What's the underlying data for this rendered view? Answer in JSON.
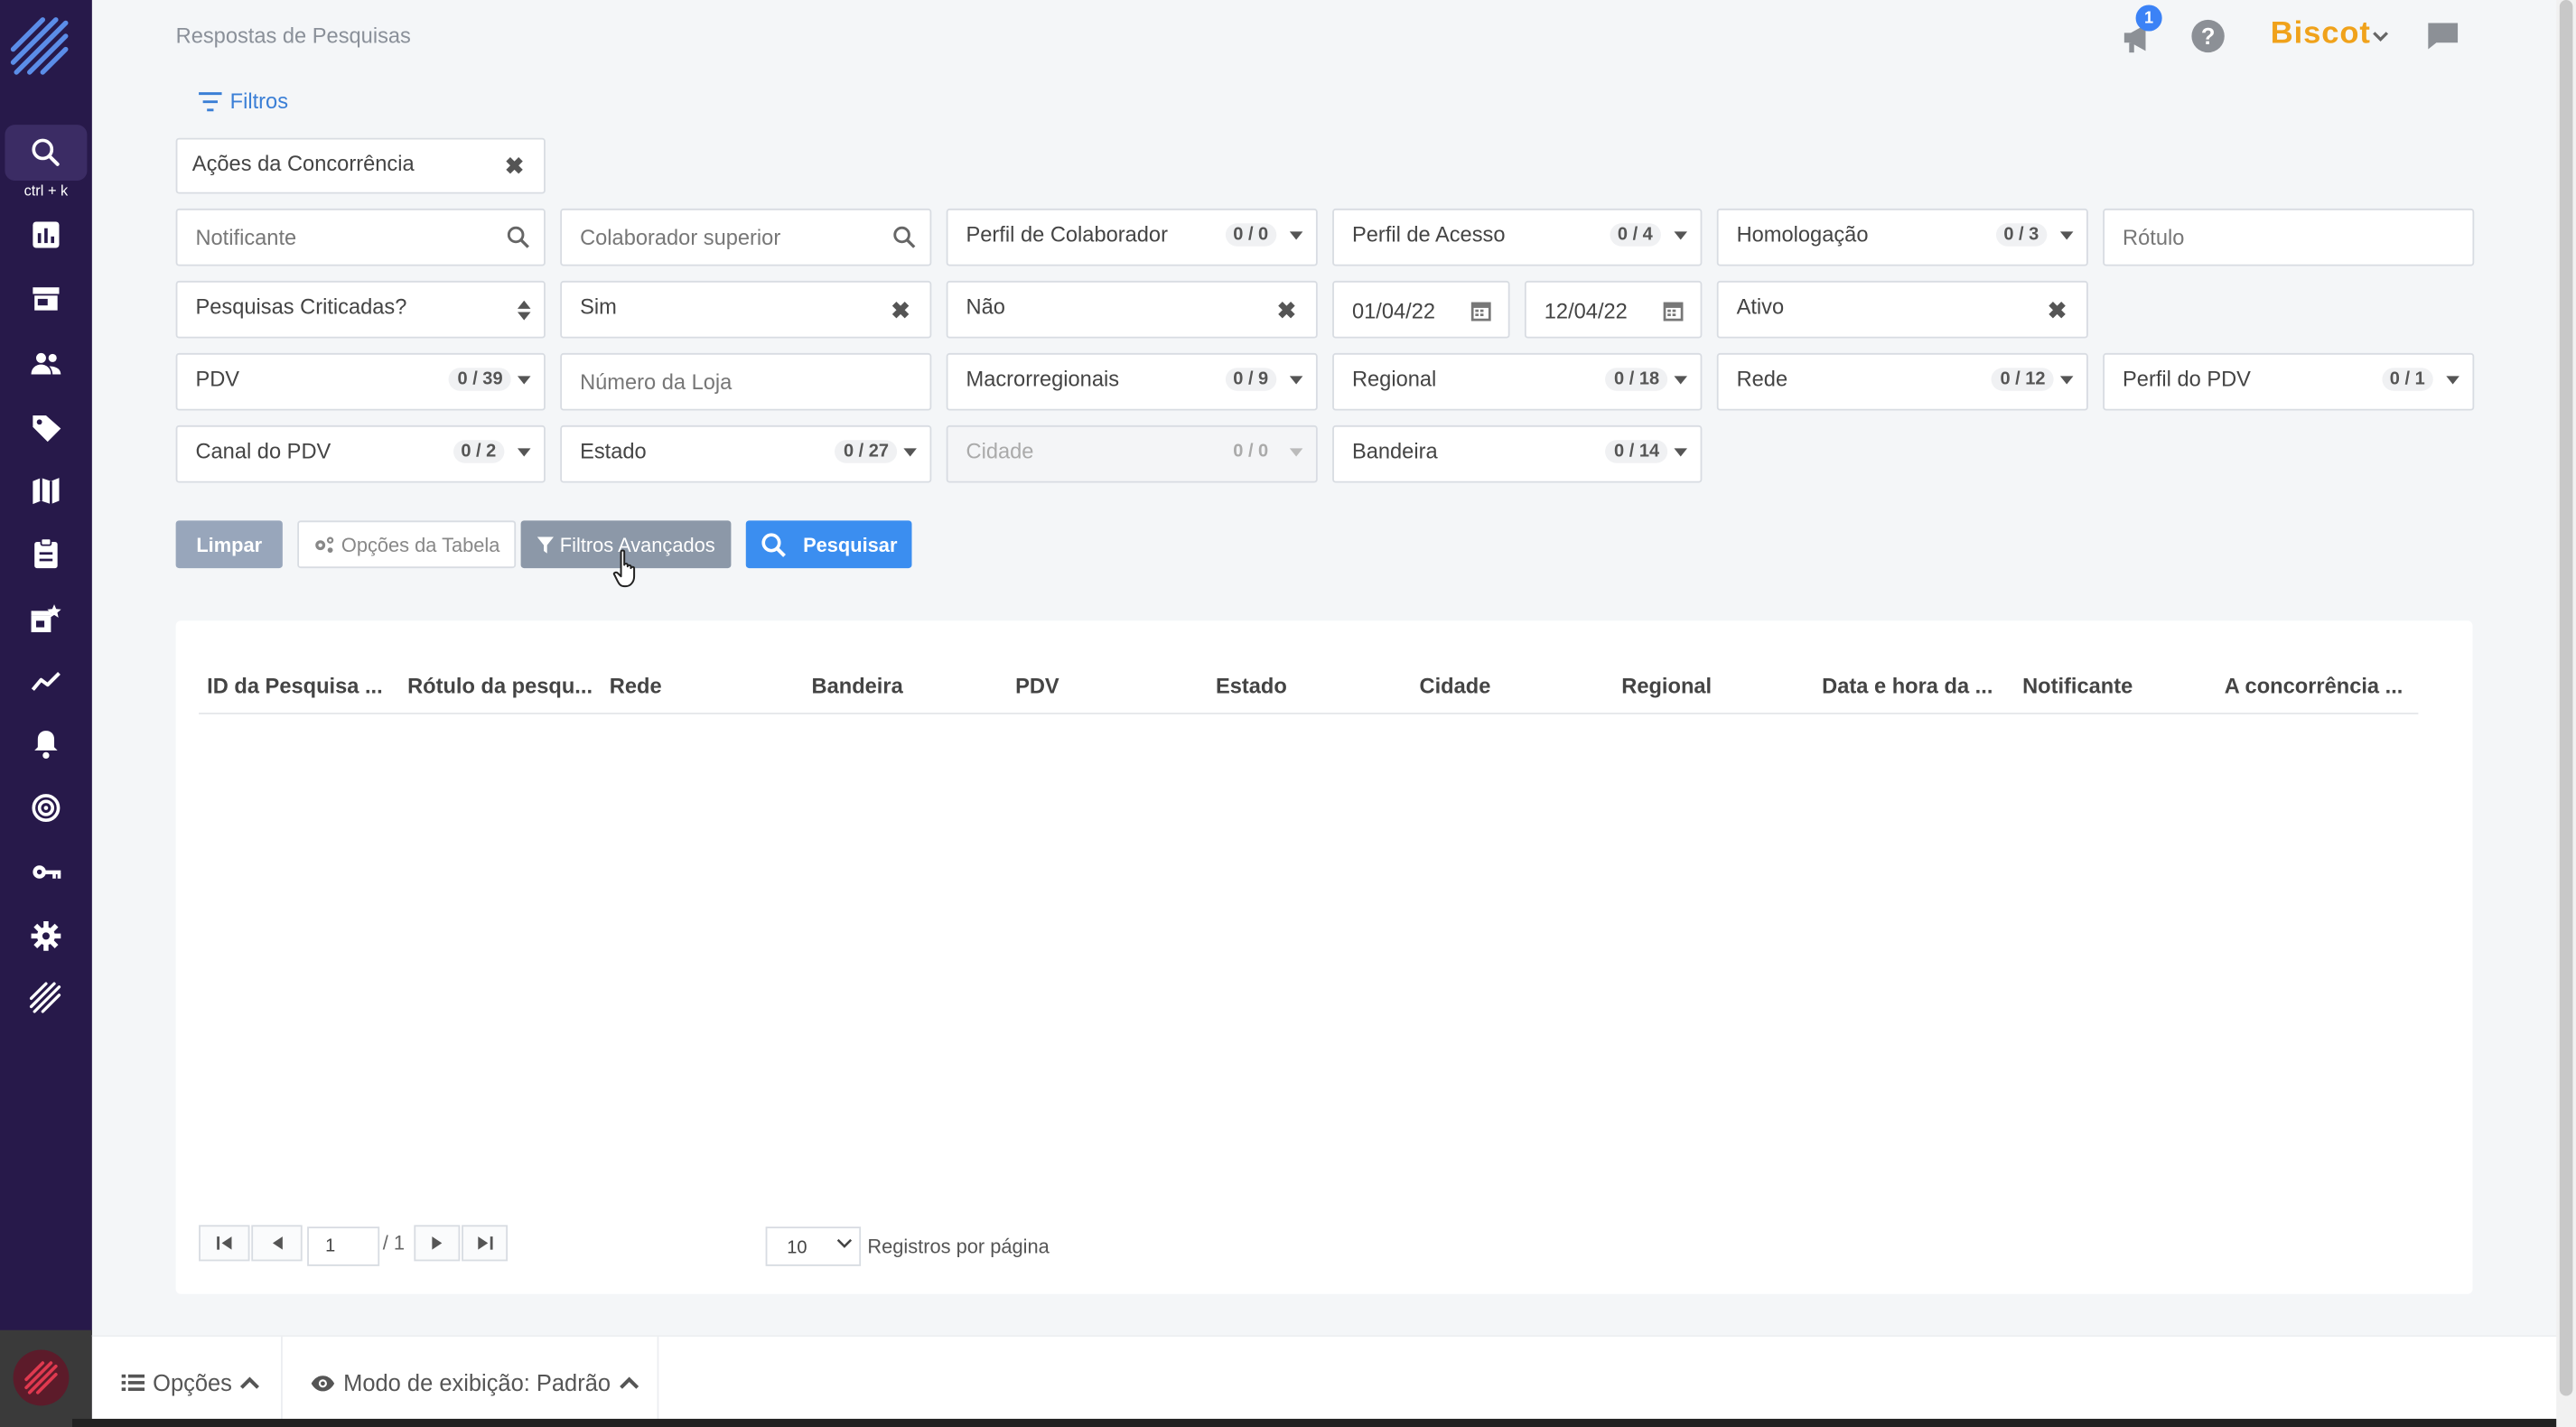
{
  "breadcrumb": "Respostas de Pesquisas",
  "sidebar": {
    "shortcut": "ctrl + k",
    "items": [
      {
        "name": "search-icon"
      },
      {
        "name": "chart-icon"
      },
      {
        "name": "store-icon"
      },
      {
        "name": "users-icon"
      },
      {
        "name": "tag-icon"
      },
      {
        "name": "map-icon"
      },
      {
        "name": "clipboard-icon"
      },
      {
        "name": "store-star-icon"
      },
      {
        "name": "trend-icon"
      },
      {
        "name": "bell-icon"
      },
      {
        "name": "target-icon"
      },
      {
        "name": "key-icon"
      },
      {
        "name": "gear-icon"
      },
      {
        "name": "brand-stripes-icon"
      }
    ]
  },
  "header": {
    "notification_count": "1",
    "help": "?",
    "brand": "Biscot",
    "brand_color": "#f0a21b"
  },
  "filters_link": "Filtros",
  "survey_select": "Ações da Concorrência",
  "fields": {
    "notificante": "Notificante",
    "colaborador_superior": "Colaborador superior",
    "perfil_colaborador": {
      "label": "Perfil de Colaborador",
      "count": "0 / 0"
    },
    "perfil_acesso": {
      "label": "Perfil de Acesso",
      "count": "0 / 4"
    },
    "homologacao": {
      "label": "Homologação",
      "count": "0 / 3"
    },
    "rotulo": "Rótulo",
    "pesquisas_criticadas": "Pesquisas Criticadas?",
    "sim": "Sim",
    "nao": "Não",
    "date_from": "01/04/22",
    "date_to": "12/04/22",
    "ativo": "Ativo",
    "pdv": {
      "label": "PDV",
      "count": "0 / 39"
    },
    "numero_loja": "Número da Loja",
    "macrorregionais": {
      "label": "Macrorregionais",
      "count": "0 / 9"
    },
    "regional": {
      "label": "Regional",
      "count": "0 / 18"
    },
    "rede": {
      "label": "Rede",
      "count": "0 / 12"
    },
    "perfil_pdv": {
      "label": "Perfil do PDV",
      "count": "0 / 1"
    },
    "canal_pdv": {
      "label": "Canal do PDV",
      "count": "0 / 2"
    },
    "estado": {
      "label": "Estado",
      "count": "0 / 27"
    },
    "cidade": {
      "label": "Cidade",
      "count": "0 / 0"
    },
    "bandeira": {
      "label": "Bandeira",
      "count": "0 / 14"
    }
  },
  "buttons": {
    "limpar": "Limpar",
    "opcoes_tabela": "Opções da Tabela",
    "filtros_avancados": "Filtros Avançados",
    "pesquisar": "Pesquisar"
  },
  "table": {
    "columns": [
      "ID da Pesquisa ...",
      "Rótulo da pesqu...",
      "Rede",
      "Bandeira",
      "PDV",
      "Estado",
      "Cidade",
      "Regional",
      "Data e hora da ...",
      "Notificante",
      "A concorrência ..."
    ],
    "rows": []
  },
  "pagination": {
    "current_page": "1",
    "total": "/ 1",
    "per_page": "10",
    "per_page_label": "Registros por página"
  },
  "footer": {
    "opcoes": "Opções",
    "modo_exibicao": "Modo de exibição: Padrão"
  }
}
